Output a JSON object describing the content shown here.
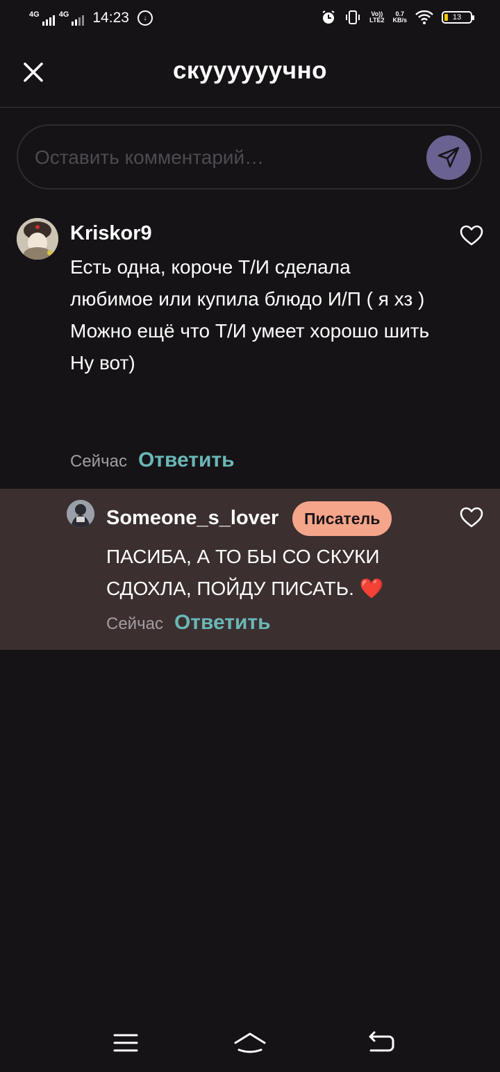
{
  "status_bar": {
    "network1": "4G",
    "network2": "4G",
    "time": "14:23",
    "volte": "Vo))",
    "lte": "LTE2",
    "speed": "0.7",
    "speed_unit": "KB/s",
    "battery": "13"
  },
  "header": {
    "title": "скуууууучно"
  },
  "comment_input": {
    "placeholder": "Оставить комментарий…"
  },
  "comments": [
    {
      "username": "Kriskor9",
      "text": "Есть одна, короче Т/И сделала любимое или купила блюдо И/П ( я хз )\nМожно ещё что Т/И умеет хорошо шить\nНу вот)",
      "time": "Сейчас",
      "reply_label": "Ответить"
    },
    {
      "username": "Someone_s_lover",
      "badge": "Писатель",
      "text": "ПАСИБА, А ТО БЫ СО СКУКИ СДОХЛА, ПОЙДУ ПИСАТЬ.",
      "emoji": "❤️",
      "time": "Сейчас",
      "reply_label": "Ответить"
    }
  ],
  "colors": {
    "background": "#161316",
    "reply_background": "#3c2f2f",
    "accent_reply": "#6ab7b7",
    "badge": "#f4a58a",
    "send_button": "#6a6290"
  }
}
